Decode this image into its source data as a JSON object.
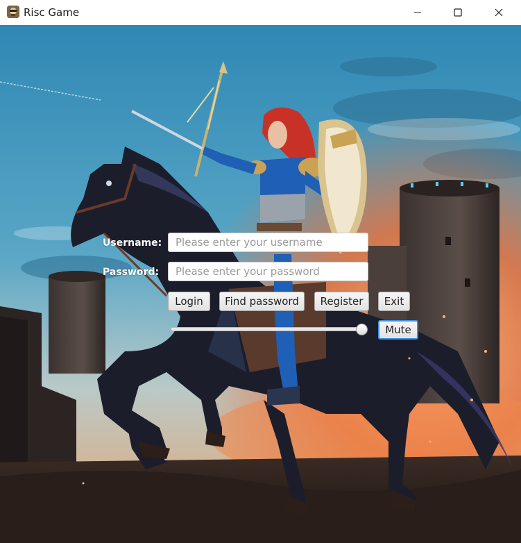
{
  "window": {
    "title": "Risc Game",
    "icon": "app-logo-icon",
    "controls": {
      "minimize_icon": "minimize-icon",
      "maximize_icon": "maximize-icon",
      "close_icon": "close-icon"
    }
  },
  "login": {
    "username_label": "Username:",
    "username_placeholder": "Please enter your username",
    "username_value": "",
    "password_label": "Password:",
    "password_placeholder": "Please enter your password",
    "password_value": ""
  },
  "buttons": {
    "login": "Login",
    "find_password": "Find password",
    "register": "Register",
    "exit": "Exit",
    "mute": "Mute"
  },
  "volume": {
    "level": 1.0
  },
  "colors": {
    "focus_border": "#3d8ee6",
    "label_text": "#ffffff",
    "sky": "#3a8fb8",
    "fire": "#e8703a"
  }
}
